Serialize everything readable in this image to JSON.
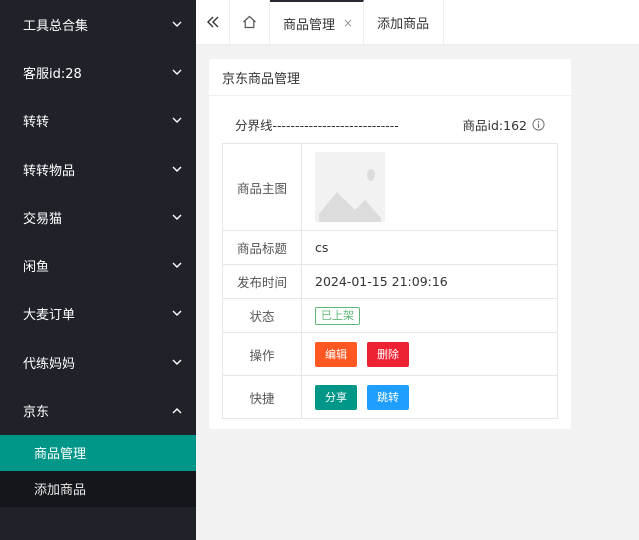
{
  "sidebar": {
    "items": [
      {
        "label": "工具总合集",
        "expanded": false
      },
      {
        "label": "客服id:28",
        "expanded": false
      },
      {
        "label": "转转",
        "expanded": false
      },
      {
        "label": "转转物品",
        "expanded": false
      },
      {
        "label": "交易猫",
        "expanded": false
      },
      {
        "label": "闲鱼",
        "expanded": false
      },
      {
        "label": "大麦订单",
        "expanded": false
      },
      {
        "label": "代练妈妈",
        "expanded": false
      },
      {
        "label": "京东",
        "expanded": true
      }
    ],
    "submenu": [
      {
        "label": "商品管理",
        "active": true
      },
      {
        "label": "添加商品",
        "active": false
      }
    ]
  },
  "tabs": {
    "items": [
      {
        "label": "商品管理",
        "active": true,
        "close": "×"
      },
      {
        "label": "添加商品",
        "active": false
      }
    ]
  },
  "card": {
    "title": "京东商品管理",
    "divider_text": "分界线----------------------------",
    "product_id": "商品id:162",
    "rows": {
      "image_label": "商品主图",
      "title_label": "商品标题",
      "title_value": "cs",
      "time_label": "发布时间",
      "time_value": "2024-01-15 21:09:16",
      "status_label": "状态",
      "status_value": "已上架",
      "action_label": "操作",
      "edit_label": "编辑",
      "delete_label": "删除",
      "quick_label": "快捷",
      "share_label": "分享",
      "jump_label": "跳转"
    }
  },
  "colors": {
    "sidebar_bg": "#20222a",
    "submenu_active": "#009688",
    "status_green": "#5fb878",
    "edit_orange": "#ff5722",
    "delete_red": "#ee2233",
    "share_teal": "#009688",
    "jump_blue": "#1e9fff"
  }
}
